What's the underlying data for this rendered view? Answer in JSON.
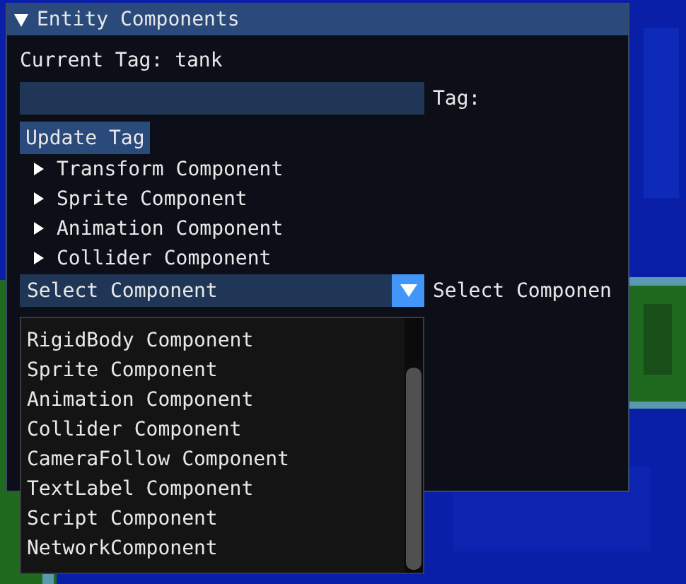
{
  "window": {
    "title": "Entity Components",
    "expanded": true
  },
  "current_tag": "Current Tag: tank",
  "tag_field": {
    "label": "Tag:"
  },
  "update_button": "Update Tag",
  "components": [
    {
      "label": "Transform Component",
      "expanded": false
    },
    {
      "label": "Sprite Component",
      "expanded": false
    },
    {
      "label": "Animation Component",
      "expanded": false
    },
    {
      "label": "Collider Component",
      "expanded": false
    }
  ],
  "combo": {
    "value": "Select Component",
    "label": "Select Componen",
    "open": true
  },
  "dropdown_items": [
    {
      "label": "RigidBody Component",
      "selected": false
    },
    {
      "label": "Sprite Component",
      "selected": false
    },
    {
      "label": "Animation Component",
      "selected": false
    },
    {
      "label": "Collider Component",
      "selected": false
    },
    {
      "label": "CameraFollow Component",
      "selected": false
    },
    {
      "label": "TextLabel Component",
      "selected": false
    },
    {
      "label": "Script Component",
      "selected": false
    },
    {
      "label": "NetworkComponent",
      "selected": false
    }
  ]
}
